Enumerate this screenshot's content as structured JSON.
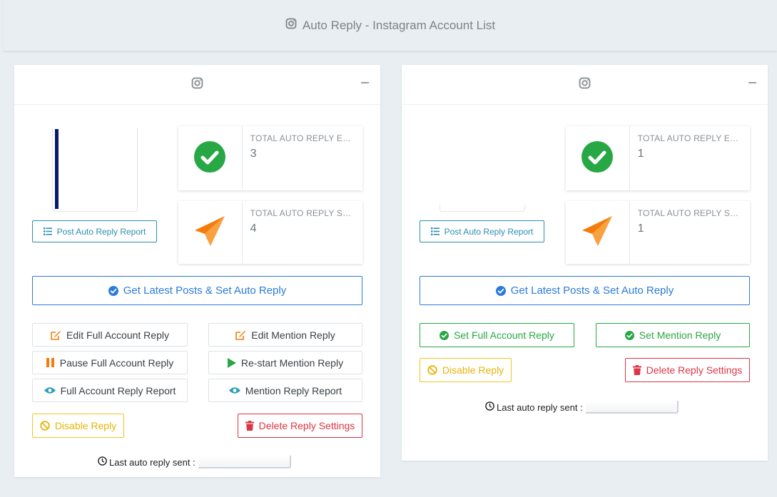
{
  "header": {
    "title": "Auto Reply - Instagram Account List"
  },
  "colors": {
    "success": "#28a745",
    "primary": "#2c7bd8",
    "info": "#2b8fb0",
    "warning": "#f3c520",
    "danger": "#dc3545",
    "send": "#f57c0c"
  },
  "cards": [
    {
      "stats": [
        {
          "label": "TOTAL AUTO REPLY ENABLED POST",
          "value": "3",
          "icon": "check-circle-icon"
        },
        {
          "label": "TOTAL AUTO REPLY SENT",
          "value": "4",
          "icon": "paper-plane-icon"
        }
      ],
      "report_label": "Post Auto Reply Report",
      "get_posts_label": "Get Latest Posts & Set Auto Reply",
      "edit_full_label": "Edit Full Account Reply",
      "edit_mention_label": "Edit Mention Reply",
      "pause_full_label": "Pause Full Account Reply",
      "restart_mention_label": "Re-start Mention Reply",
      "full_report_label": "Full Account Reply Report",
      "mention_report_label": "Mention Reply Report",
      "disable_label": "Disable Reply",
      "delete_label": "Delete Reply Settings",
      "last_sent_label": "Last auto reply sent :"
    },
    {
      "stats": [
        {
          "label": "TOTAL AUTO REPLY ENABLED POST",
          "value": "1",
          "icon": "check-circle-icon"
        },
        {
          "label": "TOTAL AUTO REPLY SENT",
          "value": "1",
          "icon": "paper-plane-icon"
        }
      ],
      "report_label": "Post Auto Reply Report",
      "get_posts_label": "Get Latest Posts & Set Auto Reply",
      "set_full_label": "Set Full Account Reply",
      "set_mention_label": "Set Mention Reply",
      "disable_label": "Disable Reply",
      "delete_label": "Delete Reply Settings",
      "last_sent_label": "Last auto reply sent :"
    }
  ]
}
